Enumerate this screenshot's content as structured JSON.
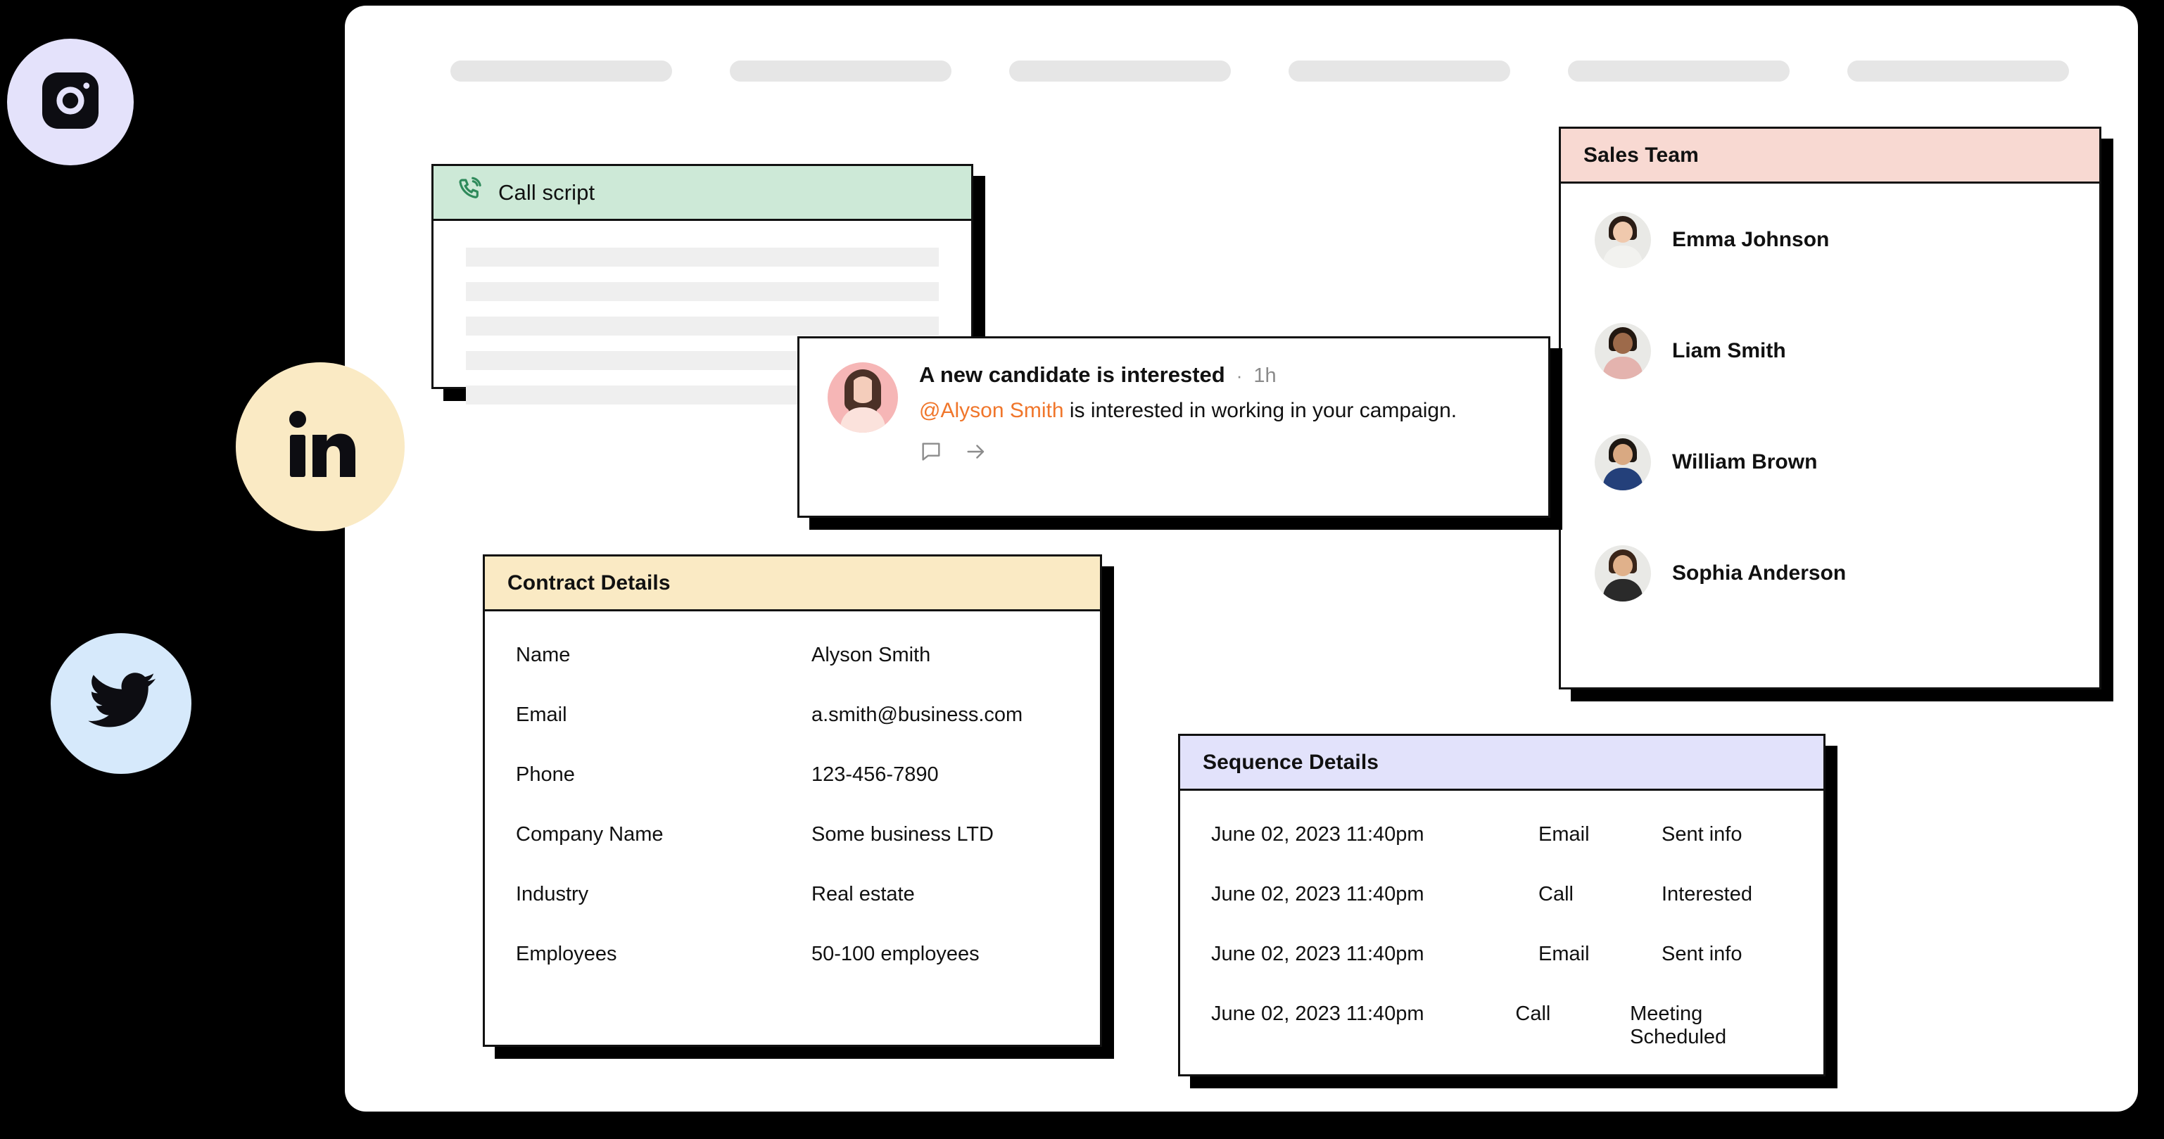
{
  "window": {
    "name": "crm-app-window"
  },
  "nav": {
    "skeleton_pill_count": 6
  },
  "call_script": {
    "title": "Call script",
    "icon": "phone-call-icon",
    "header_color": "#cde9d7",
    "skeleton_line_count": 5
  },
  "notification": {
    "title": "A new candidate is interested",
    "separator": "·",
    "time": "1h",
    "mention": "@Alyson Smith",
    "message_rest": " is interested in working in your campaign.",
    "mention_color": "#f0762b",
    "actions": [
      {
        "icon": "comment-icon"
      },
      {
        "icon": "arrow-right-icon"
      }
    ]
  },
  "sales_team": {
    "title": "Sales Team",
    "header_color": "#f8d9d2",
    "members": [
      {
        "name": "Emma Johnson"
      },
      {
        "name": "Liam Smith"
      },
      {
        "name": "William Brown"
      },
      {
        "name": "Sophia Anderson"
      }
    ]
  },
  "contract": {
    "title": "Contract Details",
    "header_color": "#faeac4",
    "rows": [
      {
        "key": "Name",
        "value": "Alyson Smith"
      },
      {
        "key": "Email",
        "value": "a.smith@business.com"
      },
      {
        "key": "Phone",
        "value": "123-456-7890"
      },
      {
        "key": "Company Name",
        "value": "Some business LTD"
      },
      {
        "key": "Industry",
        "value": "Real estate"
      },
      {
        "key": "Employees",
        "value": "50-100 employees"
      }
    ]
  },
  "sequence": {
    "title": "Sequence Details",
    "header_color": "#e2e2fb",
    "rows": [
      {
        "date": "June 02, 2023 11:40pm",
        "type": "Email",
        "status": "Sent info"
      },
      {
        "date": "June 02, 2023 11:40pm",
        "type": "Call",
        "status": "Interested"
      },
      {
        "date": "June 02, 2023 11:40pm",
        "type": "Email",
        "status": "Sent info"
      },
      {
        "date": "June 02, 2023 11:40pm",
        "type": "Call",
        "status": "Meeting Scheduled"
      }
    ]
  },
  "social": [
    {
      "icon": "instagram-icon",
      "background": "#e4e2fb"
    },
    {
      "icon": "linkedin-icon",
      "background": "#faeac4"
    },
    {
      "icon": "twitter-icon",
      "background": "#d6e9fb"
    }
  ]
}
